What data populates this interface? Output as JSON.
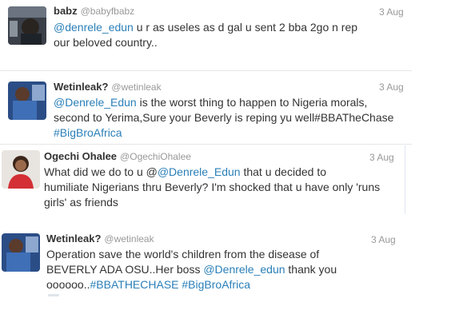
{
  "tweets": [
    {
      "name": "babz",
      "handle": "@babyfbabz",
      "date": "3 Aug",
      "parts": [
        "@denrele_edun",
        " u r as useles as d gal u sent 2 bba 2go n rep",
        "our beloved country.."
      ]
    },
    {
      "name": "Wetinleak?",
      "handle": "@wetinleak",
      "date": "3 Aug",
      "parts": [
        "@Denrele_Edun",
        " is the worst thing to happen to Nigeria morals,",
        "second to Yerima,Sure your Beverly is reping yu well#BBATheChase",
        "#BigBroAfrica"
      ]
    },
    {
      "name": "Ogechi Ohalee",
      "handle": "@OgechiOhalee",
      "date": "3 Aug",
      "parts": [
        "What did we do to u @",
        "@Denrele_Edun",
        " that u decided to",
        "humiliate Nigerians thru Beverly? I'm shocked that u have only 'runs",
        "girls' as friends"
      ]
    },
    {
      "name": "Wetinleak?",
      "handle": "@wetinleak",
      "date": "3 Aug",
      "parts": [
        "Operation save the world's children from the disease of",
        "BEVERLY ADA OSU..Her boss ",
        "@Denrele_edun",
        " thank you",
        "oooooo..",
        "#BBATHECHASE",
        " ",
        "#BigBroAfrica"
      ]
    }
  ],
  "colors": {
    "link": "#2a7fb8",
    "meta": "#999999"
  }
}
